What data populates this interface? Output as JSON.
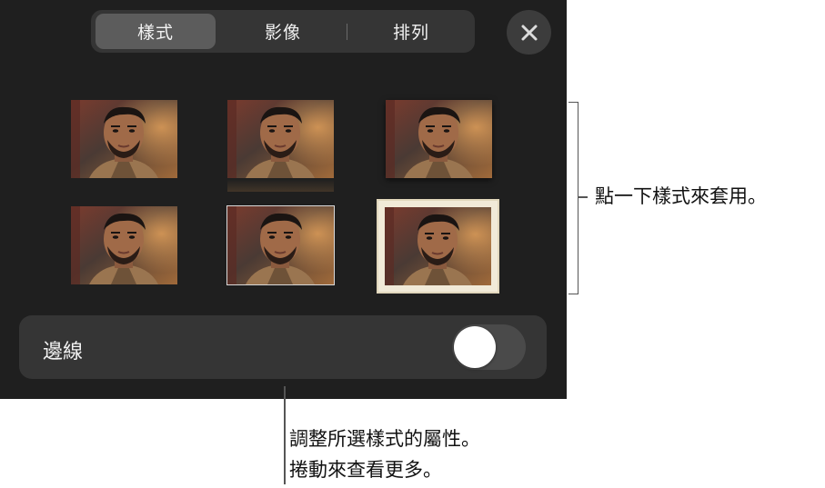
{
  "tabs": [
    {
      "label": "樣式",
      "active": true
    },
    {
      "label": "影像",
      "active": false
    },
    {
      "label": "排列",
      "active": false
    }
  ],
  "close_icon": "close-icon",
  "styles": [
    {
      "name": "plain"
    },
    {
      "name": "reflection"
    },
    {
      "name": "shadow"
    },
    {
      "name": "plain-2"
    },
    {
      "name": "thin-border"
    },
    {
      "name": "cream-frame"
    }
  ],
  "border": {
    "label": "邊線",
    "toggle_on": false
  },
  "callouts": {
    "right": "點一下樣式來套用。",
    "bottom_line1": "調整所選樣式的屬性。",
    "bottom_line2": "捲動來查看更多。"
  },
  "colors": {
    "panel": "#1f1f1f",
    "segment": "#353535",
    "active_segment": "#5c5c5c"
  }
}
